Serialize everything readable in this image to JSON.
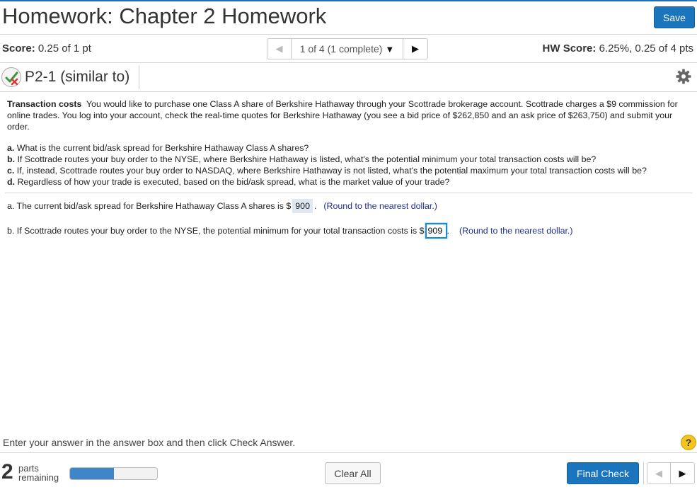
{
  "header": {
    "title": "Homework: Chapter 2 Homework",
    "save_label": "Save"
  },
  "score_bar": {
    "score_label": "Score:",
    "score_value": "0.25 of 1 pt",
    "nav_label": "1 of 4 (1 complete)",
    "hw_score_label": "HW Score:",
    "hw_score_value": "6.25%, 0.25 of 4 pts"
  },
  "question": {
    "icon": "partial-credit-icon",
    "title": "P2-1 (similar to)",
    "settings_icon": "gear-icon",
    "intro_heading": "Transaction costs",
    "intro_text": "You would like to purchase one Class A share of Berkshire Hathaway through your Scottrade brokerage account. Scottrade charges a $9 commission for online trades. You log into your account, check the real-time quotes for Berkshire Hathaway (you see a bid price of $262,850 and an ask price of $263,750) and submit your order.",
    "parts": [
      {
        "letter": "a.",
        "text": "What is the current bid/ask spread for Berkshire Hathaway Class A shares?"
      },
      {
        "letter": "b.",
        "text": "If Scottrade routes your buy order to the NYSE, where Berkshire Hathaway is listed, what's the potential minimum your total transaction costs will be?"
      },
      {
        "letter": "c.",
        "text": "If, instead, Scottrade routes your buy order to NASDAQ, where Berkshire Hathaway is not listed, what's the potential maximum your total transaction costs will be?"
      },
      {
        "letter": "d.",
        "text": "Regardless of how your trade is executed, based on the bid/ask spread, what is the market value of your trade?"
      }
    ]
  },
  "answers": {
    "a_prefix": "a. The current bid/ask spread for Berkshire Hathaway Class A shares is $",
    "a_value": "900",
    "a_suffix": ".",
    "a_hint": "(Round to the nearest dollar.)",
    "b_prefix": "b. If Scottrade routes your buy order to the NYSE, the potential minimum for your total transaction costs is $",
    "b_value": "909",
    "b_suffix": ".",
    "b_hint": "(Round to the nearest dollar.)"
  },
  "footer": {
    "instructions": "Enter your answer in the answer box and then click Check Answer.",
    "help_label": "?",
    "parts_count": "2",
    "parts_line1": "parts",
    "parts_line2": "remaining",
    "progress_fraction": 0.5,
    "clear_label": "Clear All",
    "final_label": "Final Check"
  },
  "colors": {
    "accent": "#1b75bc",
    "hint": "#1f2f8f",
    "help": "#f4c51f",
    "progress": "#3f86c8"
  }
}
